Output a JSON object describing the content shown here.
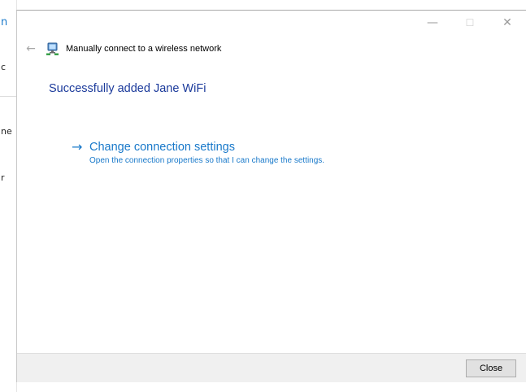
{
  "background_window": {
    "fragments": [
      "n",
      "c",
      "ne",
      "r"
    ]
  },
  "dialog": {
    "title": "Manually connect to a wireless network",
    "window_controls": {
      "minimize": "—",
      "maximize": "☐",
      "close": "✕"
    },
    "back_glyph": "←",
    "icon": "wireless-network-icon",
    "success_heading": "Successfully added Jane WiFi",
    "command_link": {
      "arrow": "→",
      "title": "Change connection settings",
      "description": "Open the connection properties so that I can change the settings."
    },
    "footer": {
      "close_label": "Close"
    }
  },
  "colors": {
    "heading": "#1b3a9b",
    "link": "#1979ca",
    "footer_bg": "#f0f0f0"
  }
}
